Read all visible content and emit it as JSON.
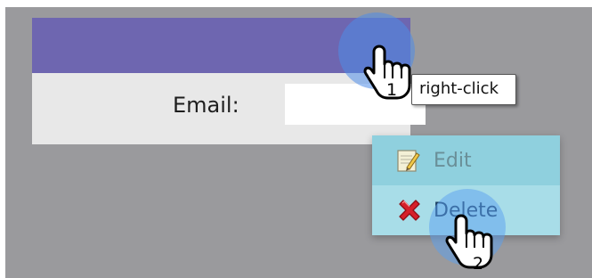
{
  "form": {
    "email_label": "Email:",
    "email_value": ""
  },
  "context_menu": {
    "items": [
      {
        "label": "Edit",
        "icon": "edit-notepad-icon",
        "state": "disabled"
      },
      {
        "label": "Delete",
        "icon": "delete-x-icon",
        "state": "hovered"
      }
    ]
  },
  "steps": [
    {
      "number": "1",
      "action": "right-click"
    },
    {
      "number": "2"
    }
  ],
  "colors": {
    "header": "#6e66b0",
    "backdrop": "#9a9a9d",
    "menu": "#8fd0de",
    "menu_hover": "#a8dde8",
    "click_highlight": "#4e8ce8"
  }
}
